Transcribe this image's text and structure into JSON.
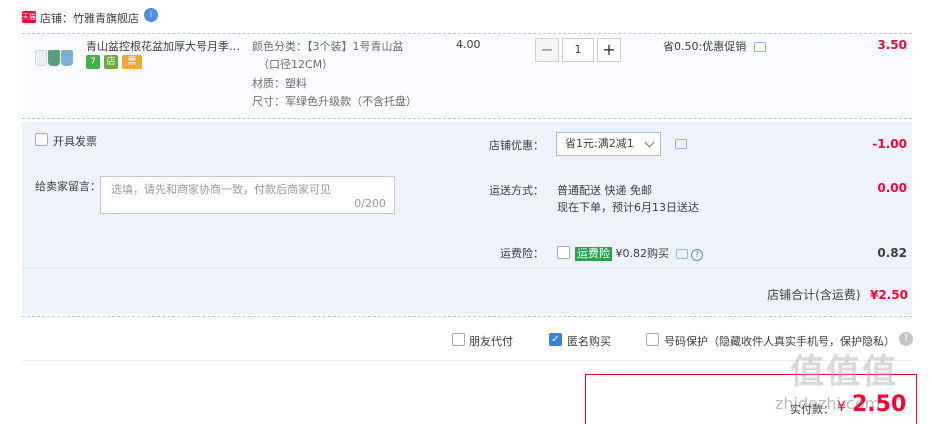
{
  "shop": {
    "badge": "天猫",
    "label": "店铺：竹雅青旗舰店",
    "icon": "info-badge-icon"
  },
  "item": {
    "title": "青山盆控根花盆加厚大号月季绿...",
    "sku_lines": [
      "颜色分类：【3个装】1号青山盆",
      "（口径12CM）",
      "材质：塑料",
      "尺寸：军绿色升级款（不含托盘）"
    ],
    "unit_price": "4.00",
    "quantity": "1",
    "minus": "−",
    "plus": "+",
    "promo": "省0.50:优惠促销",
    "subtotal": "3.50",
    "badges": [
      "7",
      "店",
      "票"
    ]
  },
  "invoice": {
    "label": "开具发票"
  },
  "memo": {
    "label": "给卖家留言：",
    "placeholder": "选填，请先和商家协商一致，付款后商家可见",
    "count": "0/200"
  },
  "shop_discount": {
    "label": "店铺优惠：",
    "selected": "省1元:满2减1",
    "amount": "-1.00"
  },
  "shipping": {
    "label": "运送方式：",
    "method": "普通配送 快递 免邮",
    "eta": "现在下单，预计6月13日送达",
    "amount": "0.00"
  },
  "insurance": {
    "label": "运费险：",
    "tag": "运费险",
    "text": "¥0.82购买",
    "amount": "0.82"
  },
  "shop_total": {
    "label": "店铺合计(含运费)",
    "amount": "¥2.50"
  },
  "options": {
    "friend_pay": "朋友代付",
    "anonymous": "匿名购买",
    "number_protect": "号码保护（隐藏收件人真实手机号，保护隐私）",
    "help": "?"
  },
  "pay": {
    "label": "实付款：",
    "currency": "¥",
    "amount": "2.50"
  },
  "watermark": {
    "text": "值值值",
    "sub": "zhidezhi.com"
  },
  "colors": {
    "accent_red": "#ff0036",
    "panel_bg": "#eef3fb",
    "checked_blue": "#3d7ed8",
    "insurance_green": "#2d9f52"
  }
}
